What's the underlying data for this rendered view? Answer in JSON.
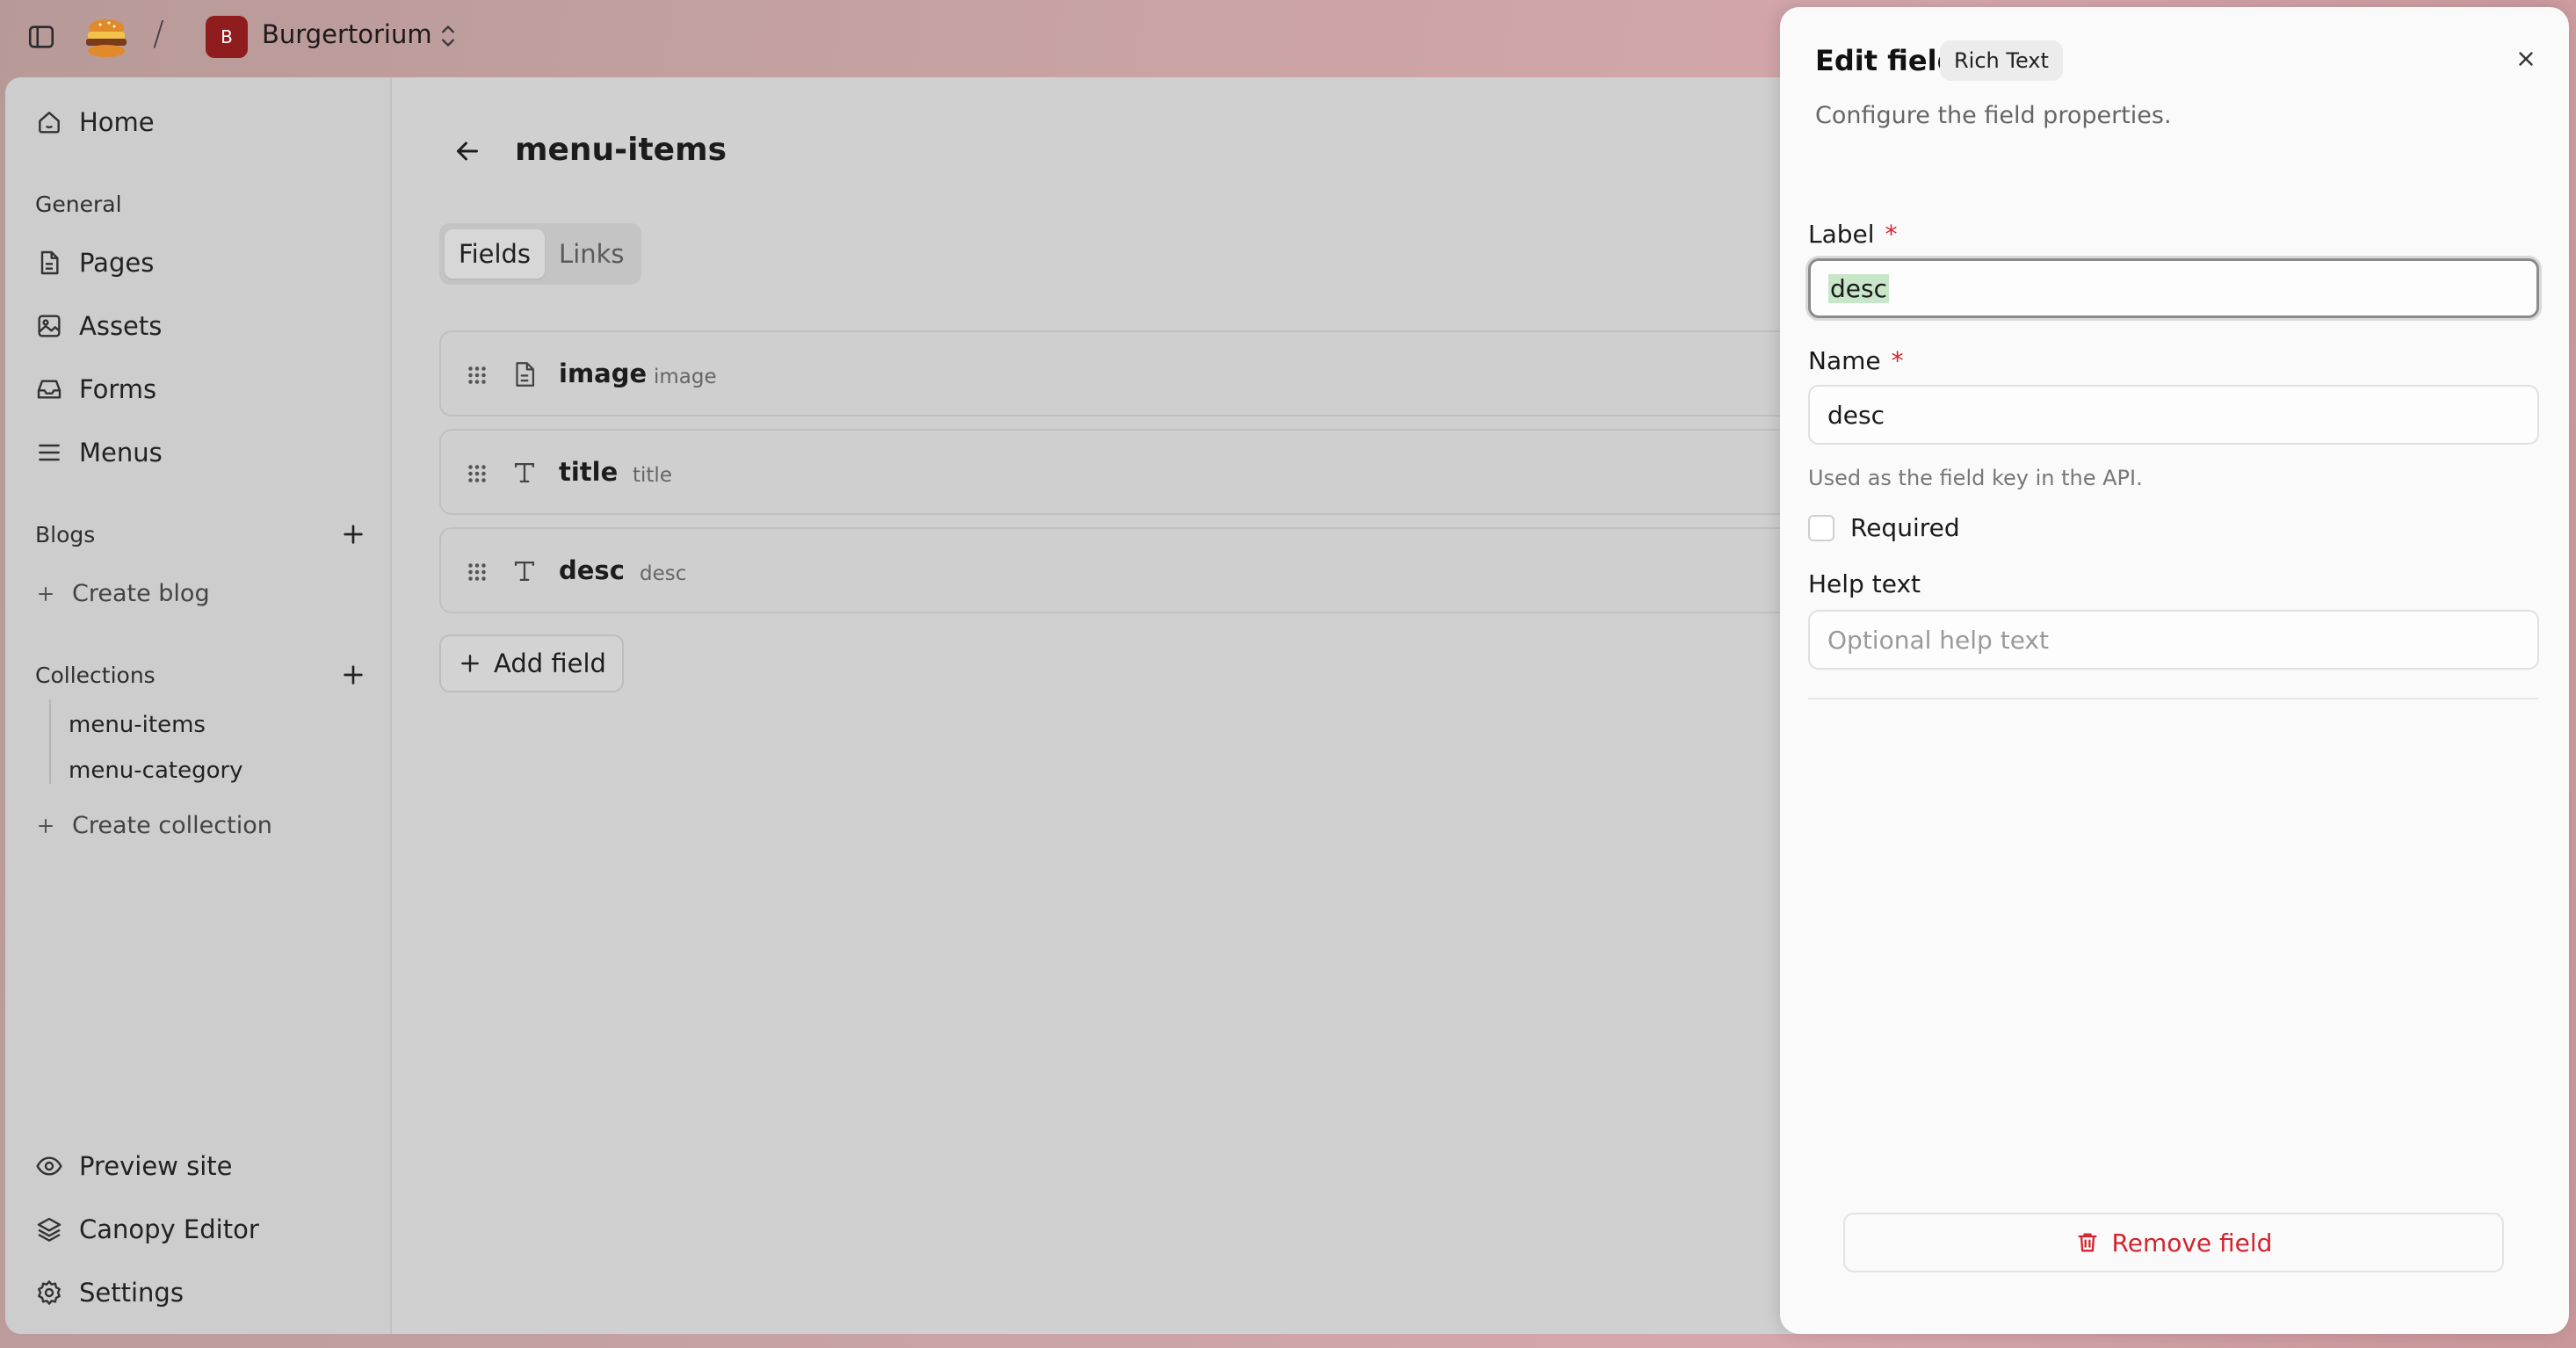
{
  "topbar": {
    "workspace_initial": "B",
    "workspace_name": "Burgertorium",
    "separator": "/"
  },
  "sidebar": {
    "home": "Home",
    "general_label": "General",
    "general_items": [
      "Pages",
      "Assets",
      "Forms",
      "Menus"
    ],
    "blogs_label": "Blogs",
    "create_blog": "Create blog",
    "collections_label": "Collections",
    "collections": [
      "menu-items",
      "menu-category"
    ],
    "create_collection": "Create collection",
    "footer_items": [
      "Preview site",
      "Canopy Editor",
      "Settings"
    ]
  },
  "main": {
    "title": "menu-items",
    "tabs": [
      {
        "label": "Fields",
        "active": true
      },
      {
        "label": "Links",
        "active": false
      }
    ],
    "fields": [
      {
        "name": "image",
        "key": "image",
        "icon": "file-icon"
      },
      {
        "name": "title",
        "key": "title",
        "icon": "text-type-icon"
      },
      {
        "name": "desc",
        "key": "desc",
        "icon": "text-type-icon"
      }
    ],
    "add_field": "Add field"
  },
  "panel": {
    "title": "Edit field",
    "type_badge": "Rich Text",
    "description": "Configure the field properties.",
    "label_label": "Label",
    "label_value": "desc",
    "name_label": "Name",
    "name_value": "desc",
    "required_mark": "*",
    "name_hint": "Used as the field key in the API.",
    "required_label": "Required",
    "help_label": "Help text",
    "help_placeholder": "Optional help text",
    "remove_label": "Remove field"
  },
  "colors": {
    "accent_danger": "#d1242f",
    "workspace_avatar": "#8f1d1d",
    "selection_highlight": "#c8e6c9"
  }
}
